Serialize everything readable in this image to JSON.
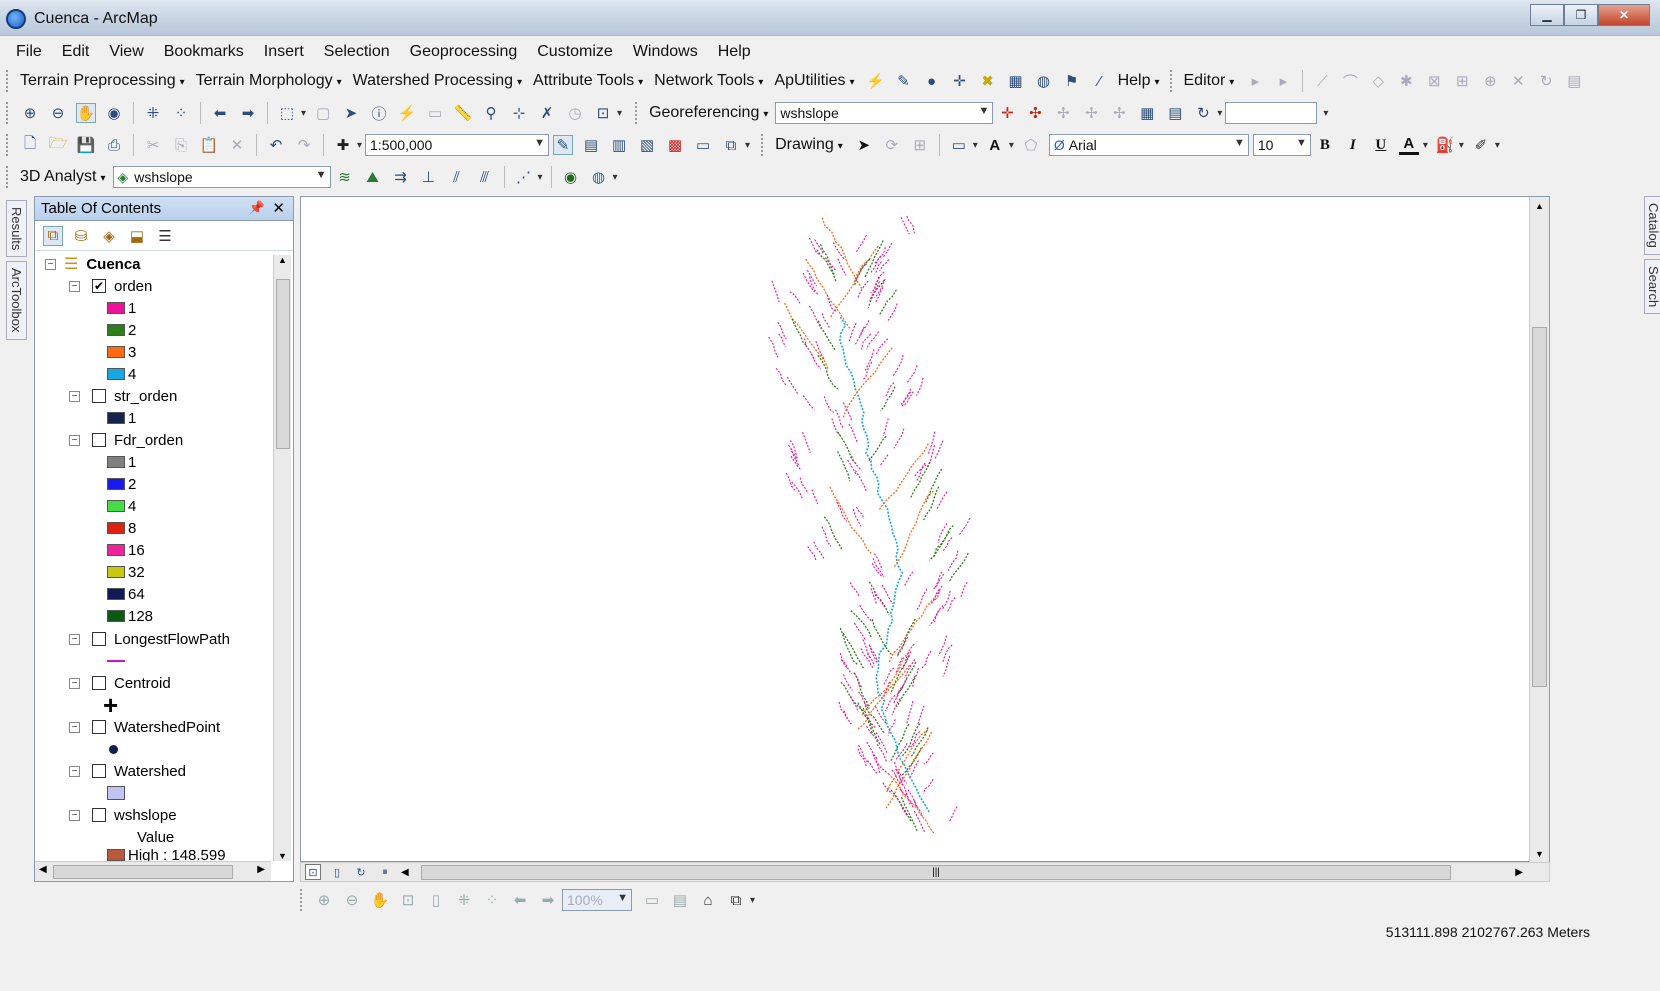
{
  "window": {
    "title": "Cuenca - ArcMap"
  },
  "menu": [
    "File",
    "Edit",
    "View",
    "Bookmarks",
    "Insert",
    "Selection",
    "Geoprocessing",
    "Customize",
    "Windows",
    "Help"
  ],
  "toolbar_archydro": {
    "menus": [
      "Terrain Preprocessing",
      "Terrain Morphology",
      "Watershed Processing",
      "Attribute Tools",
      "Network Tools",
      "ApUtilities"
    ],
    "help_label": "Help",
    "editor_label": "Editor"
  },
  "toolbar_georef": {
    "label": "Georeferencing",
    "layer_value": "wshslope"
  },
  "toolbar_standard": {
    "scale_value": "1:500,000"
  },
  "toolbar_drawing": {
    "label": "Drawing",
    "font_value": "Arial",
    "size_value": "10",
    "bold": "B",
    "italic": "I",
    "underline": "U",
    "fontcolor": "A"
  },
  "toolbar_3d": {
    "label": "3D Analyst",
    "layer_value": "wshslope"
  },
  "left_tabs": [
    "Results",
    "ArcToolbox"
  ],
  "right_tabs": [
    "Catalog",
    "Search"
  ],
  "toc": {
    "title": "Table Of Contents",
    "dataframe": "Cuenca",
    "layers": [
      {
        "name": "orden",
        "checked": true,
        "classes": [
          {
            "label": "1",
            "color": "#ee1199"
          },
          {
            "label": "2",
            "color": "#2e7d1a"
          },
          {
            "label": "3",
            "color": "#ff6a13"
          },
          {
            "label": "4",
            "color": "#16a6e0"
          }
        ]
      },
      {
        "name": "str_orden",
        "checked": false,
        "classes": [
          {
            "label": "1",
            "color": "#14244d"
          }
        ]
      },
      {
        "name": "Fdr_orden",
        "checked": false,
        "classes": [
          {
            "label": "1",
            "color": "#808080"
          },
          {
            "label": "2",
            "color": "#1a1aee"
          },
          {
            "label": "4",
            "color": "#44dd44"
          },
          {
            "label": "8",
            "color": "#dd2211"
          },
          {
            "label": "16",
            "color": "#ee2299"
          },
          {
            "label": "32",
            "color": "#c8c810"
          },
          {
            "label": "64",
            "color": "#101a55"
          },
          {
            "label": "128",
            "color": "#0b5a14"
          }
        ]
      },
      {
        "name": "LongestFlowPath",
        "checked": false,
        "symbol": "line",
        "color": "#d010d0"
      },
      {
        "name": "Centroid",
        "checked": false,
        "symbol": "cross",
        "color": "#000000"
      },
      {
        "name": "WatershedPoint",
        "checked": false,
        "symbol": "dot",
        "color": "#101a55"
      },
      {
        "name": "Watershed",
        "checked": false,
        "symbol": "fill",
        "color": "#c0c4ee"
      },
      {
        "name": "wshslope",
        "checked": false,
        "value_label": "Value",
        "high_label": "High : 148.599",
        "color": "#b85a3a"
      }
    ]
  },
  "status": {
    "coordinates": "513111.898  2102767.263 Meters"
  },
  "layout_toolbar": {
    "zoom_value": "100%"
  }
}
